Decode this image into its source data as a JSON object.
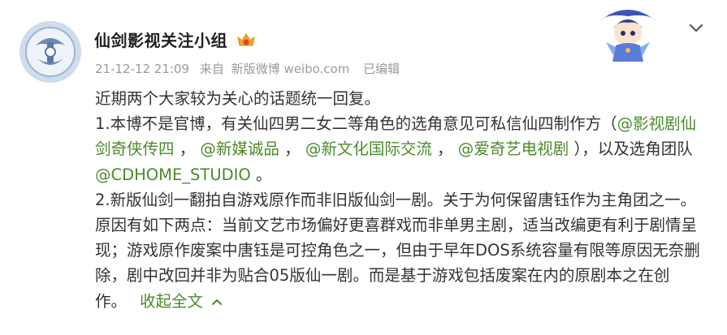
{
  "user": {
    "name": "仙剑影视关注小组",
    "badge": "vip-crown-icon"
  },
  "meta": {
    "time": "21-12-12 21:09",
    "source_prefix": "来自",
    "source": "新版微博 weibo.com",
    "edited": "已编辑"
  },
  "post": {
    "line1": "近期两个大家较为关心的话题统一回复。",
    "p1_prefix": "1.本博不是官博，有关仙四男二女二等角色的选角意见可私信仙四制作方（",
    "mention1": "@影视剧仙剑奇侠传四",
    "sep1": " ，",
    "mention2": "@新媒诚品",
    "sep2": " ，",
    "mention3": "@新文化国际交流",
    "sep3": " ，",
    "mention4": "@爱奇艺电视剧",
    "p1_mid": " ），以及选角团队",
    "mention5": "@CDHOME_STUDIO",
    "p1_end": " 。",
    "p2": "2.新版仙剑一翻拍自游戏原作而非旧版仙剑一剧。关于为何保留唐钰作为主角团之一。原因有如下两点：当前文艺市场偏好更喜群戏而非单男主剧，适当改编更有利于剧情呈现；游戏原作废案中唐钰是可控角色之一，但由于早年DOS系统容量有限等原因无奈删除，剧中改回并非为贴合05版仙一剧。而是基于游戏包括废案在内的原剧本之在创作。",
    "collapse_label": "收起全文"
  },
  "colors": {
    "mention": "#4b8a2a",
    "meta": "#9a9a9a",
    "text": "#333333"
  }
}
